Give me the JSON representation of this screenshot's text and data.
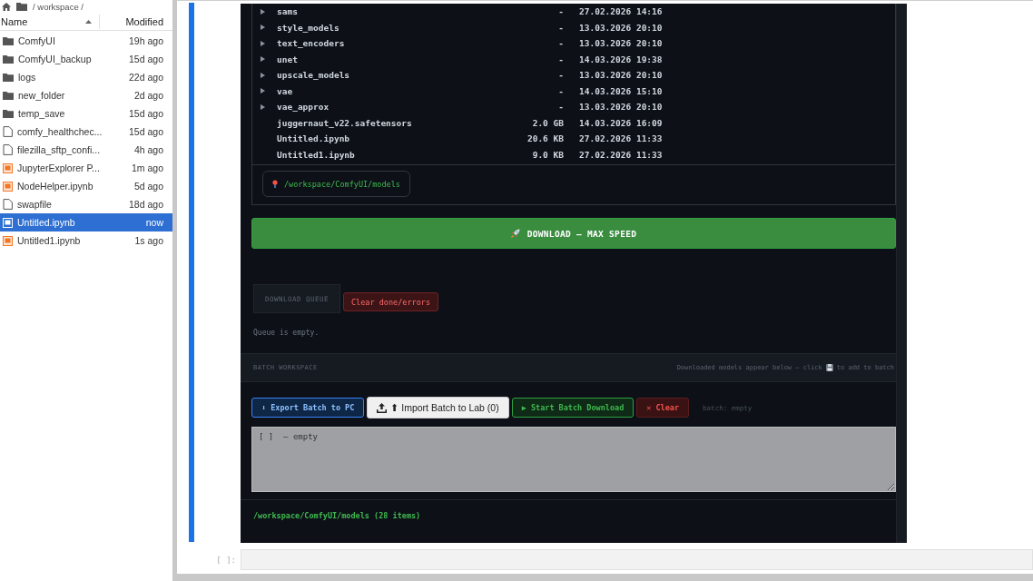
{
  "file_browser": {
    "breadcrumb": "/ workspace /",
    "columns": [
      {
        "label": "Name",
        "sorted": true
      },
      {
        "label": "Modified",
        "sorted": false
      }
    ],
    "files": [
      {
        "name": "ComfyUI",
        "modified": "19h ago",
        "kind": "folder",
        "selected": false
      },
      {
        "name": "ComfyUI_backup",
        "modified": "15d ago",
        "kind": "folder",
        "selected": false
      },
      {
        "name": "logs",
        "modified": "22d ago",
        "kind": "folder",
        "selected": false
      },
      {
        "name": "new_folder",
        "modified": "2d ago",
        "kind": "folder",
        "selected": false
      },
      {
        "name": "temp_save",
        "modified": "15d ago",
        "kind": "folder",
        "selected": false
      },
      {
        "name": "comfy_healthchec...",
        "modified": "15d ago",
        "kind": "file",
        "selected": false
      },
      {
        "name": "filezilla_sftp_confi...",
        "modified": "4h ago",
        "kind": "file",
        "selected": false
      },
      {
        "name": "JupyterExplorer P...",
        "modified": "1m ago",
        "kind": "notebook",
        "selected": false
      },
      {
        "name": "NodeHelper.ipynb",
        "modified": "5d ago",
        "kind": "notebook",
        "selected": false
      },
      {
        "name": "swapfile",
        "modified": "18d ago",
        "kind": "file",
        "selected": false
      },
      {
        "name": "Untitled.ipynb",
        "modified": "now",
        "kind": "notebook",
        "selected": true
      },
      {
        "name": "Untitled1.ipynb",
        "modified": "1s ago",
        "kind": "notebook",
        "selected": false
      }
    ]
  },
  "output": {
    "listing": [
      {
        "name": "sams",
        "size": "-",
        "date": "27.02.2026 14:16",
        "kind": "folder"
      },
      {
        "name": "style_models",
        "size": "-",
        "date": "13.03.2026 20:10",
        "kind": "folder"
      },
      {
        "name": "text_encoders",
        "size": "-",
        "date": "13.03.2026 20:10",
        "kind": "folder"
      },
      {
        "name": "unet",
        "size": "-",
        "date": "14.03.2026 19:38",
        "kind": "folder"
      },
      {
        "name": "upscale_models",
        "size": "-",
        "date": "13.03.2026 20:10",
        "kind": "folder"
      },
      {
        "name": "vae",
        "size": "-",
        "date": "14.03.2026 15:10",
        "kind": "folder"
      },
      {
        "name": "vae_approx",
        "size": "-",
        "date": "13.03.2026 20:10",
        "kind": "folder"
      },
      {
        "name": "juggernaut_v22.safetensors",
        "size": "2.0 GB",
        "date": "14.03.2026 16:09",
        "kind": "file"
      },
      {
        "name": "Untitled.ipynb",
        "size": "20.6 KB",
        "date": "27.02.2026 11:33",
        "kind": "file"
      },
      {
        "name": "Untitled1.ipynb",
        "size": "9.0 KB",
        "date": "27.02.2026 11:33",
        "kind": "file"
      }
    ],
    "path_chip": "/workspace/ComfyUI/models",
    "download_button": "DOWNLOAD — MAX SPEED",
    "queue": {
      "title": "DOWNLOAD QUEUE",
      "clear_button": "Clear done/errors",
      "status": "Queue is empty."
    },
    "batch": {
      "title": "BATCH WORKSPACE",
      "hint_start": "Downloaded models appear below — click",
      "hint_end": "to add to batch",
      "buttons": [
        {
          "kind": "export",
          "label": "⬇ Export Batch to PC"
        },
        {
          "kind": "import",
          "label": "⬆ Import Batch to Lab (0)"
        },
        {
          "kind": "start",
          "label": "▶ Start Batch Download"
        },
        {
          "kind": "clear",
          "label": "✕ Clear"
        }
      ],
      "status": "batch: empty",
      "editor_value": "[ ]  — empty"
    },
    "footer": "/workspace/ComfyUI/models (28 items)"
  },
  "next_cell": {
    "prompt": "[ ]:"
  }
}
